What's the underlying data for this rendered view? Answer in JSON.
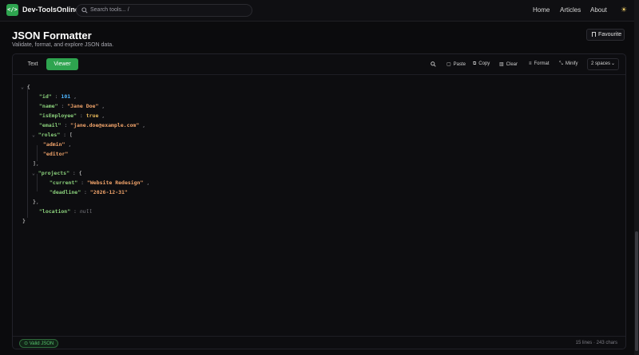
{
  "header": {
    "logo_glyph": "</>",
    "brand": "Dev-ToolsOnline",
    "search_placeholder": "Search tools... /",
    "nav": [
      "Home",
      "Articles",
      "About"
    ],
    "theme_icon": "sun-icon"
  },
  "page": {
    "title": "JSON Formatter",
    "subtitle": "Validate, format, and explore JSON data.",
    "favourite": "Favourite"
  },
  "toolbar": {
    "tabs": [
      "Text",
      "Viewer"
    ],
    "active_tab": "Viewer",
    "paste": "Paste",
    "copy": "Copy",
    "clear": "Clear",
    "format": "Format",
    "minify": "Minify",
    "indent": "2 spaces"
  },
  "json": {
    "id": "101",
    "name": "\"Jane Doe\"",
    "isEmployee": "true",
    "email": "\"jane.doe@example.com\"",
    "roles": [
      "\"admin\"",
      "\"editor\""
    ],
    "current": "\"Website Redesign\"",
    "deadline": "\"2026-12-31\"",
    "location": "null",
    "keys": {
      "id": "\"id\"",
      "name": "\"name\"",
      "isEmployee": "\"isEmployee\"",
      "email": "\"email\"",
      "roles": "\"roles\"",
      "projects": "\"projects\"",
      "current": "\"current\"",
      "deadline": "\"deadline\"",
      "location": "\"location\""
    }
  },
  "footer": {
    "status": "Valid JSON",
    "lines": "15 lines",
    "chars": "243 chars"
  },
  "colors": {
    "accent": "#2ea44f",
    "key": "#8bd17c",
    "string": "#f0a36a",
    "number": "#4fb6ff"
  }
}
